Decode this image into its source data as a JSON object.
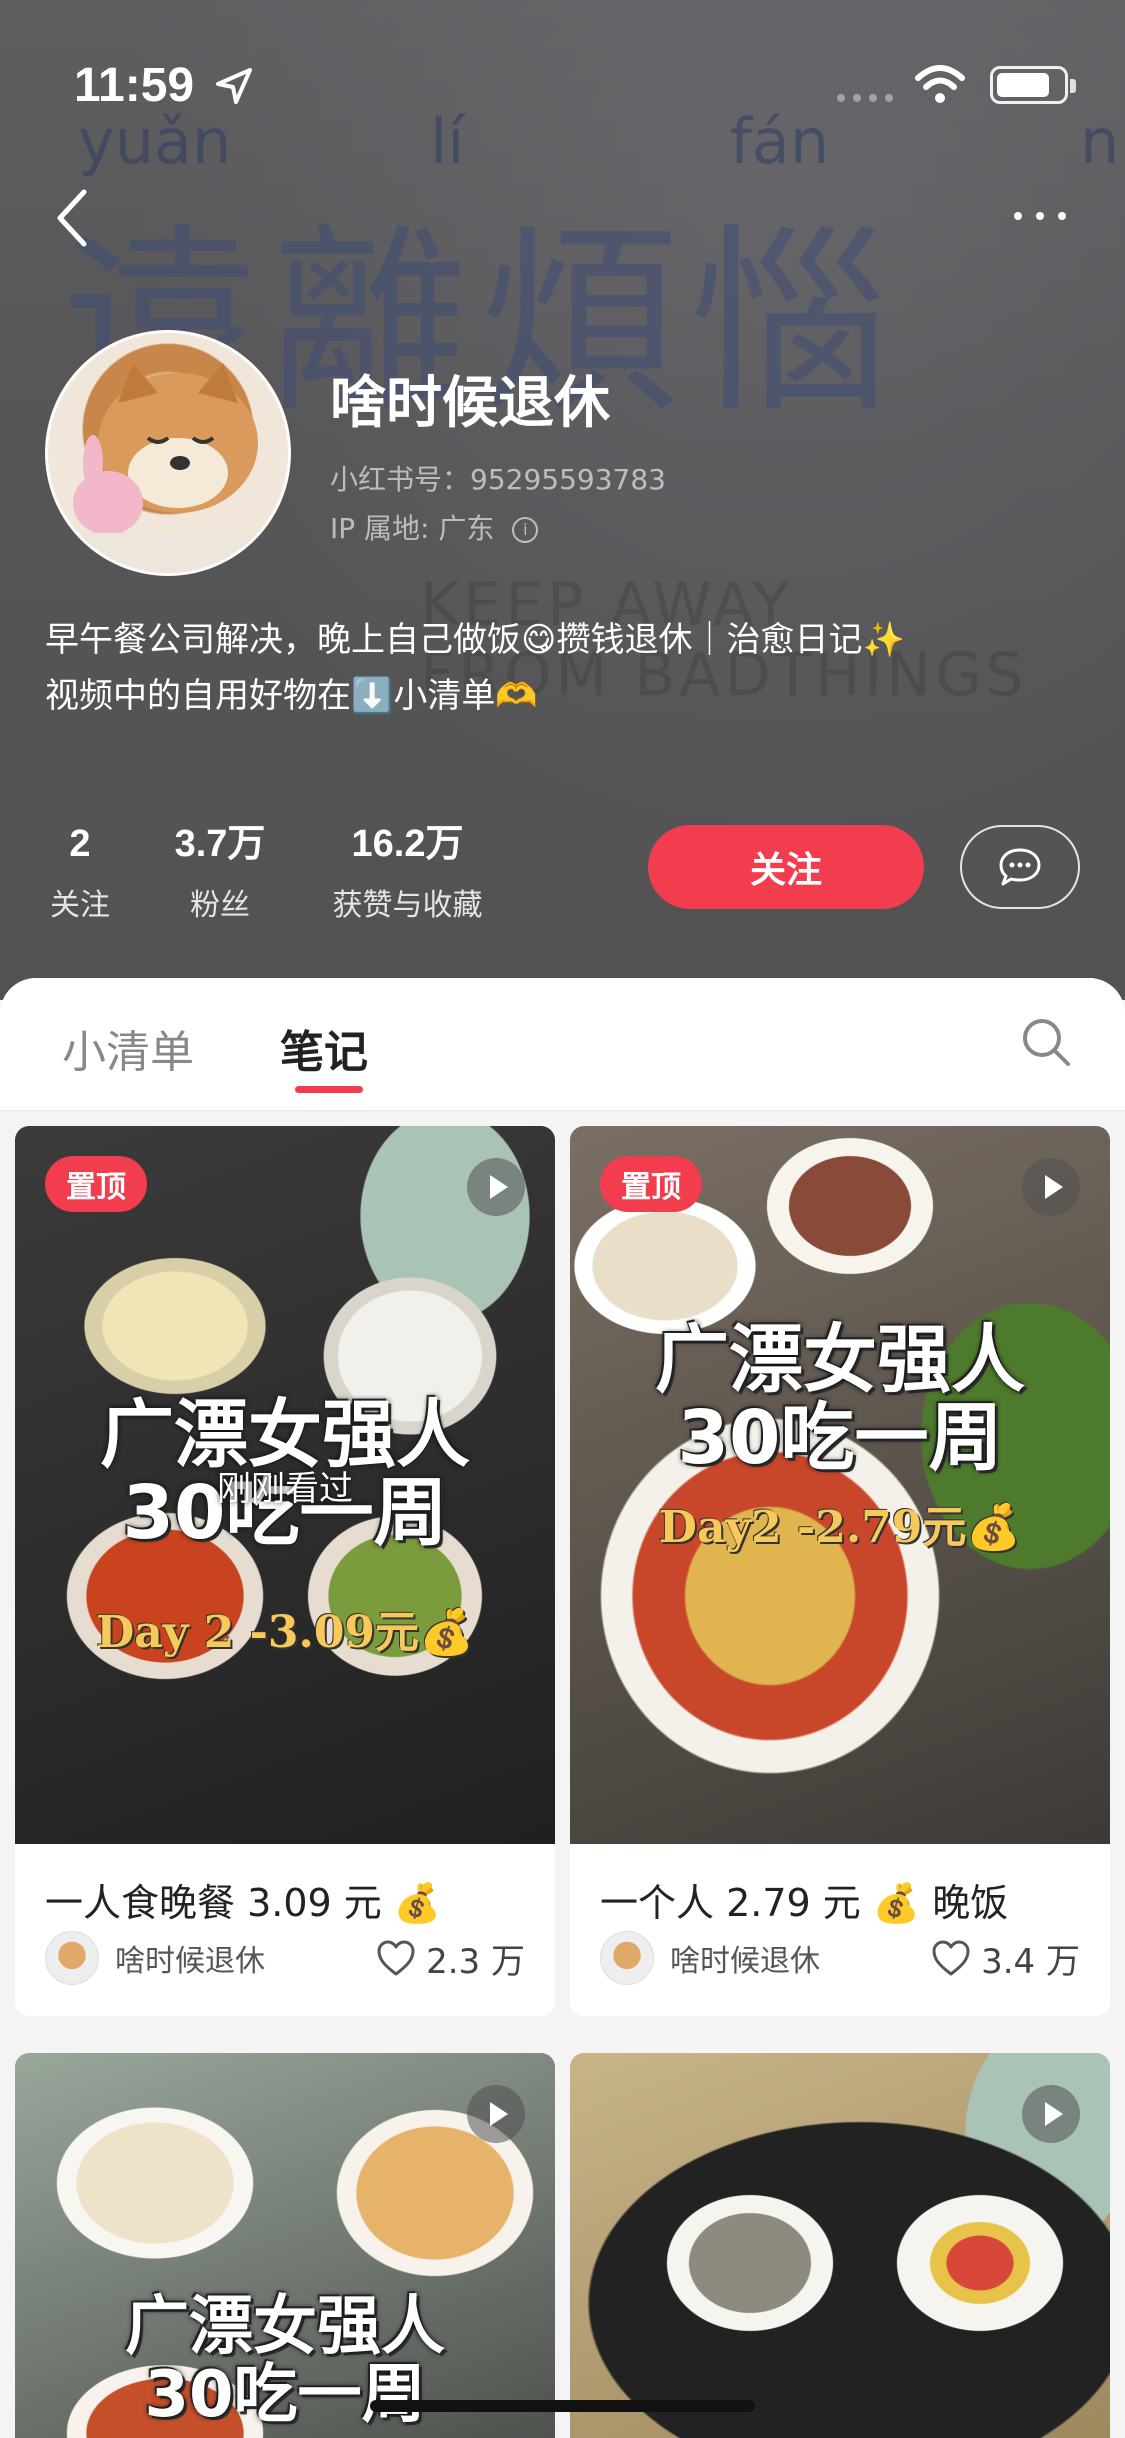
{
  "status_bar": {
    "time": "11:59"
  },
  "profile": {
    "nickname": "啥时候退休",
    "red_id": "小红书号：95295593783",
    "ip_location": "IP 属地: 广东",
    "bio_line1": "早午餐公司解决，晚上自己做饭😋攒钱退休｜治愈日记✨",
    "bio_line2": "视频中的自用好物在⬇️小清单🫶",
    "stats": [
      {
        "value": "2",
        "label": "关注"
      },
      {
        "value": "3.7万",
        "label": "粉丝"
      },
      {
        "value": "16.2万",
        "label": "获赞与收藏"
      }
    ],
    "follow_label": "关注"
  },
  "header_background": {
    "pinyin": [
      "yuǎn",
      "lí",
      "fán",
      "n"
    ],
    "characters": "遠離煩惱",
    "caption_line1": "KEEP AWAY",
    "caption_line2": "FROM BADTHINGS"
  },
  "tabs": [
    {
      "label": "小清单",
      "active": false
    },
    {
      "label": "笔记",
      "active": true
    }
  ],
  "notes": [
    {
      "pinned_label": "置顶",
      "overlay_title_line1": "广漂女强人",
      "overlay_title_line2": "30吃一周",
      "overlay_sub": "Day 2 -3.09元💰",
      "viewed_label": "刚刚看过",
      "title": "一人食晚餐 3.09 元 💰",
      "author": "啥时候退休",
      "likes": "2.3 万"
    },
    {
      "pinned_label": "置顶",
      "overlay_title_line1": "广漂女强人",
      "overlay_title_line2": "30吃一周",
      "overlay_sub": "Day2  -2.79元💰",
      "title": "一个人 2.79 元 💰 晚饭",
      "author": "啥时候退休",
      "likes": "3.4 万"
    },
    {
      "overlay_title_line1": "广漂女强人",
      "overlay_title_line2": "30吃一周"
    },
    {}
  ],
  "colors": {
    "accent": "#f23d4f",
    "header_bg": "#5f5f61",
    "page_bg": "#f4f4f4"
  }
}
